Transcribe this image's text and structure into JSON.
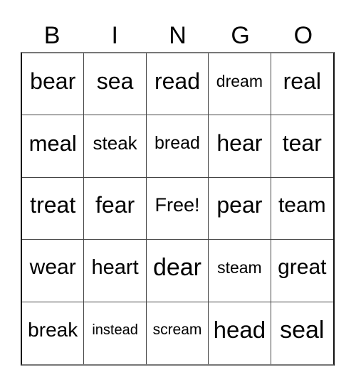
{
  "header": {
    "letters": [
      "B",
      "I",
      "N",
      "G",
      "O"
    ]
  },
  "card": {
    "cells": [
      "bear",
      "sea",
      "read",
      "dream",
      "real",
      "meal",
      "steak",
      "bread",
      "hear",
      "tear",
      "treat",
      "fear",
      "Free!",
      "pear",
      "team",
      "wear",
      "heart",
      "dear",
      "steam",
      "great",
      "break",
      "instead",
      "scream",
      "head",
      "seal"
    ]
  }
}
